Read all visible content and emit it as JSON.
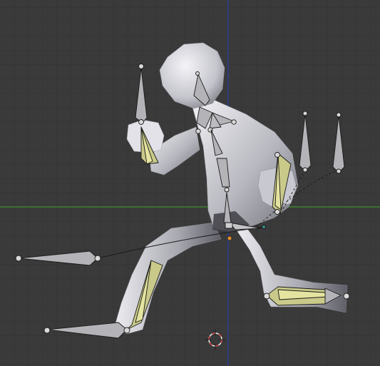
{
  "viewport": {
    "background": "#3a3a3a",
    "grid_color": "#343434",
    "x_axis_color": "#3f8f2a",
    "y_axis_color": "#2a3fb0"
  },
  "colors": {
    "mesh_light": "#e6e6ec",
    "mesh_mid": "#aeaeb6",
    "mesh_dark": "#5a5a60",
    "bone_gray": "#b4b4b8",
    "bone_selected": "#c9c98a",
    "bone_outline": "#1a1a1a",
    "cursor_red": "#d23c3c",
    "cursor_white": "#f2f2f2",
    "origin_orange": "#e08a2a"
  },
  "icons": {
    "cursor": "3d-cursor-icon",
    "origin": "object-origin-icon"
  }
}
